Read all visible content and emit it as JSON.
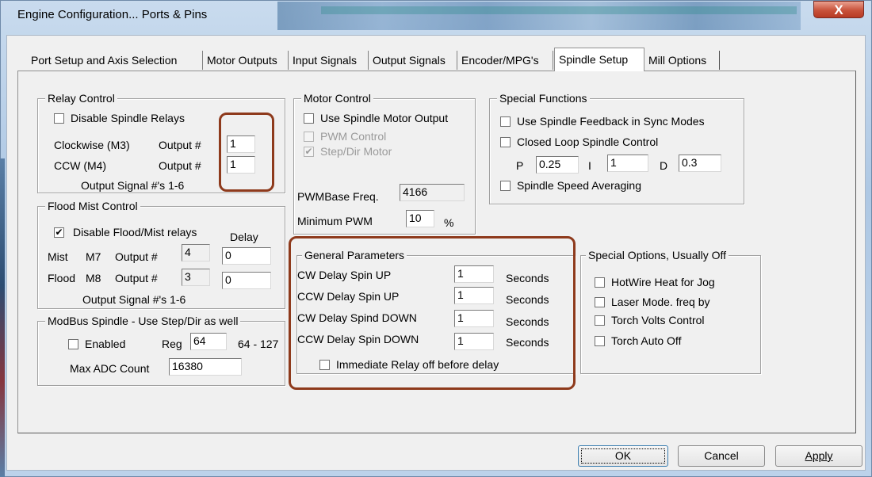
{
  "window": {
    "title": "Engine Configuration... Ports & Pins",
    "close_glyph": "X"
  },
  "tabs": [
    {
      "label": "Port Setup and Axis Selection"
    },
    {
      "label": "Motor Outputs"
    },
    {
      "label": "Input Signals"
    },
    {
      "label": "Output Signals"
    },
    {
      "label": "Encoder/MPG's"
    },
    {
      "label": "Spindle Setup"
    },
    {
      "label": "Mill Options"
    }
  ],
  "relay": {
    "title": "Relay Control",
    "disable_label": "Disable Spindle Relays",
    "disable_checked": false,
    "cw_label": "Clockwise (M3)",
    "cw_output_label": "Output #",
    "cw_value": "1",
    "ccw_label": "CCW (M4)",
    "ccw_output_label": "Output #",
    "ccw_value": "1",
    "signal_note": "Output Signal #'s 1-6"
  },
  "flood": {
    "title": "Flood Mist Control",
    "disable_label": "Disable Flood/Mist relays",
    "disable_checked": true,
    "check_glyph": "✔",
    "delay_label": "Delay",
    "mist_label": "Mist",
    "mist_code": "M7",
    "mist_output_label": "Output #",
    "mist_output": "4",
    "mist_delay": "0",
    "flood_label": "Flood",
    "flood_code": "M8",
    "flood_output_label": "Output #",
    "flood_output": "3",
    "flood_delay": "0",
    "signal_note": "Output Signal #'s 1-6"
  },
  "modbus": {
    "title": "ModBus Spindle - Use Step/Dir as well",
    "enabled_label": "Enabled",
    "enabled_checked": false,
    "reg_label": "Reg",
    "reg_value": "64",
    "reg_range": "64 - 127",
    "max_adc_label": "Max ADC Count",
    "max_adc_value": "16380"
  },
  "motor": {
    "title": "Motor Control",
    "use_label": "Use Spindle Motor Output",
    "use_checked": false,
    "pwm_label": "PWM Control",
    "pwm_checked": false,
    "stepdir_label": "Step/Dir Motor",
    "stepdir_checked": true,
    "check_glyph": "✔",
    "pwmbase_label": "PWMBase Freq.",
    "pwmbase_value": "4166",
    "minpwm_label": "Minimum PWM",
    "minpwm_value": "10",
    "minpwm_unit": "%"
  },
  "special": {
    "title": "Special Functions",
    "feedback_label": "Use Spindle Feedback in Sync Modes",
    "feedback_checked": false,
    "closed_loop_label": "Closed Loop Spindle Control",
    "closed_loop_checked": false,
    "p_label": "P",
    "p_value": "0.25",
    "i_label": "I",
    "i_value": "1",
    "d_label": "D",
    "d_value": "0.3",
    "averaging_label": "Spindle Speed Averaging",
    "averaging_checked": false
  },
  "general": {
    "title": "General Parameters",
    "rows": [
      {
        "label": "CW Delay Spin UP",
        "value": "1",
        "unit": "Seconds"
      },
      {
        "label": "CCW Delay Spin UP",
        "value": "1",
        "unit": "Seconds"
      },
      {
        "label": "CW Delay Spind DOWN",
        "value": "1",
        "unit": "Seconds"
      },
      {
        "label": "CCW Delay Spin DOWN",
        "value": "1",
        "unit": "Seconds"
      }
    ],
    "immediate_label": "Immediate Relay off before delay",
    "immediate_checked": false
  },
  "options": {
    "title": "Special Options, Usually Off",
    "items": [
      {
        "label": "HotWire Heat for Jog",
        "checked": false
      },
      {
        "label": "Laser Mode. freq by",
        "checked": false
      },
      {
        "label": "Torch Volts Control",
        "checked": false
      },
      {
        "label": "Torch Auto Off",
        "checked": false
      }
    ]
  },
  "buttons": {
    "ok": "OK",
    "cancel": "Cancel",
    "apply": "Apply"
  },
  "colors": {
    "highlight": "#8e3a1c",
    "close_button": "#c8523b"
  }
}
